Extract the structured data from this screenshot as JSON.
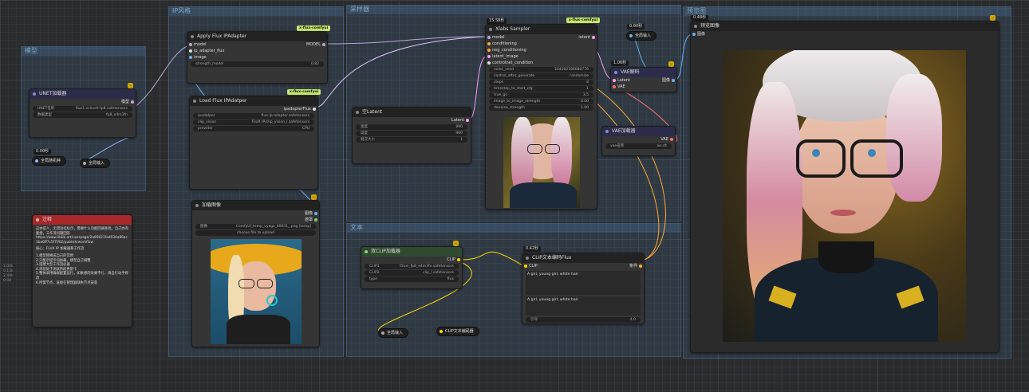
{
  "canvas": {
    "bg": "#2a2b2d"
  },
  "groups": [
    {
      "key": "g1",
      "title": "模型"
    },
    {
      "key": "g2",
      "title": "IP风格"
    },
    {
      "key": "g3",
      "title": "采样器"
    },
    {
      "key": "g4",
      "title": "文本"
    },
    {
      "key": "g5",
      "title": "预览图"
    }
  ],
  "unet": {
    "title": "UNET加载器",
    "out": "模型",
    "w1_label": "UNET名称",
    "w1_value": "flux1-schnell-fp8.safetensors",
    "w2_label": "数据类型",
    "w2_value": "fp8_e4m3fn"
  },
  "seed": {
    "time": "0.00秒",
    "label": "全局随机种",
    "global_input": "全局输入"
  },
  "note": {
    "title": "注释",
    "lines": [
      "这亦是人，无错别挂标示，需要什么功能回调查找，自己亦有能偿，工作流问题回答",
      "https://www.liblib.art/userpage/2a85621fad934a86ac1ba6ff7c5f7f/02/publish/workflow",
      "核心：FLUX IP 加载器和工作流",
      "1.模型替换成自己的常用",
      "2.只能示提示词加载，模型自己调整",
      "3.搭建大型工作流必备",
      "4.目前处于测试阶段更新卡",
      "5.整体采用确保配置运行，如果想的效果不行，请自行动手修改",
      "6.所需节点，直接在管理器缺失节点安装"
    ]
  },
  "ipa": {
    "tag": "x-flux-comfyui",
    "title": "Apply Flux IPAdapter",
    "in1": "model",
    "in2": "ip_adapter_flux",
    "in3": "image",
    "out": "MODEL",
    "w1_label": "strength_model",
    "w1_value": "0.82"
  },
  "loadipa": {
    "tag": "x-flux-comfyui",
    "title": "Load Flux IPAdatper",
    "out": "ipadapterFlux",
    "w1_label": "ipadatper",
    "w1_value": "flux-ip-adapter.safetensors",
    "w2_label": "clip_vision",
    "w2_value": "FLUX IP/clip_vision_l.safetensors",
    "w3_label": "provider",
    "w3_value": "CPU"
  },
  "loadimg": {
    "title": "加载图像",
    "out1": "图像",
    "out2": "遮罩",
    "w1_label": "图像",
    "w1_value": "ComfyUI_temp_vyagz_00031_.png [temp]",
    "upload": "choose file to upload"
  },
  "latent": {
    "title": "空Latent",
    "out": "Latent",
    "w1_label": "宽度",
    "w1_value": "800",
    "w2_label": "高度",
    "w2_value": "960",
    "w3_label": "批次大小",
    "w3_value": "1"
  },
  "sampler": {
    "time": "15.58秒",
    "tag": "x-flux-comfyui",
    "title": "Xlabs Sampler",
    "in1": "model",
    "in2": "conditioning",
    "in3": "neg_conditioning",
    "in4": "latent_image",
    "in5": "controlnet_condition",
    "out": "latent",
    "widgets": [
      [
        "noise_seed",
        "164302186688776"
      ],
      [
        "control_after_generate",
        "randomize"
      ],
      [
        "steps",
        "8"
      ],
      [
        "timestep_to_start_cfg",
        "1"
      ],
      [
        "true_gs",
        "3.5"
      ],
      [
        "image_to_image_strength",
        "0.00"
      ],
      [
        "denoise_strength",
        "1.00"
      ]
    ]
  },
  "vaedec": {
    "time": "1.06秒",
    "title": "VAE解码",
    "in1": "Latent",
    "in2": "VAE",
    "out": "图像"
  },
  "vaeload": {
    "title": "VAE加载器",
    "out": "VAE",
    "w1_label": "vae名称",
    "w1_value": "ae.sft"
  },
  "gin_top": {
    "time": "0.00秒",
    "label": "全局输入"
  },
  "dualclip": {
    "title": "双CLIP加载器",
    "out": "CLIP",
    "w1_label": "CLIP1",
    "w1_value": "t5xxl_fp8_e4m3fn.safetensors",
    "w2_label": "CLIP2",
    "w2_value": "clip_l.safetensors",
    "w3_label": "type",
    "w3_value": "flux"
  },
  "gin_bottom": {
    "label": "全局输入"
  },
  "clipenc_pill": {
    "label": "CLIP文本编码器"
  },
  "clipflux": {
    "time": "0.42秒",
    "title": "CLIP文本编码Flux",
    "in": "CLIP",
    "out": "条件",
    "text1": "A girl, young girl, white hair",
    "text2": "A girl, young girl, white hair",
    "w1_label": "引导",
    "w1_value": "4.0"
  },
  "preview": {
    "time": "0.48秒",
    "title": "预览图像",
    "in": "图像"
  },
  "left_meta": [
    "1.00k",
    "0.13k",
    "2.49k",
    "0:08"
  ]
}
